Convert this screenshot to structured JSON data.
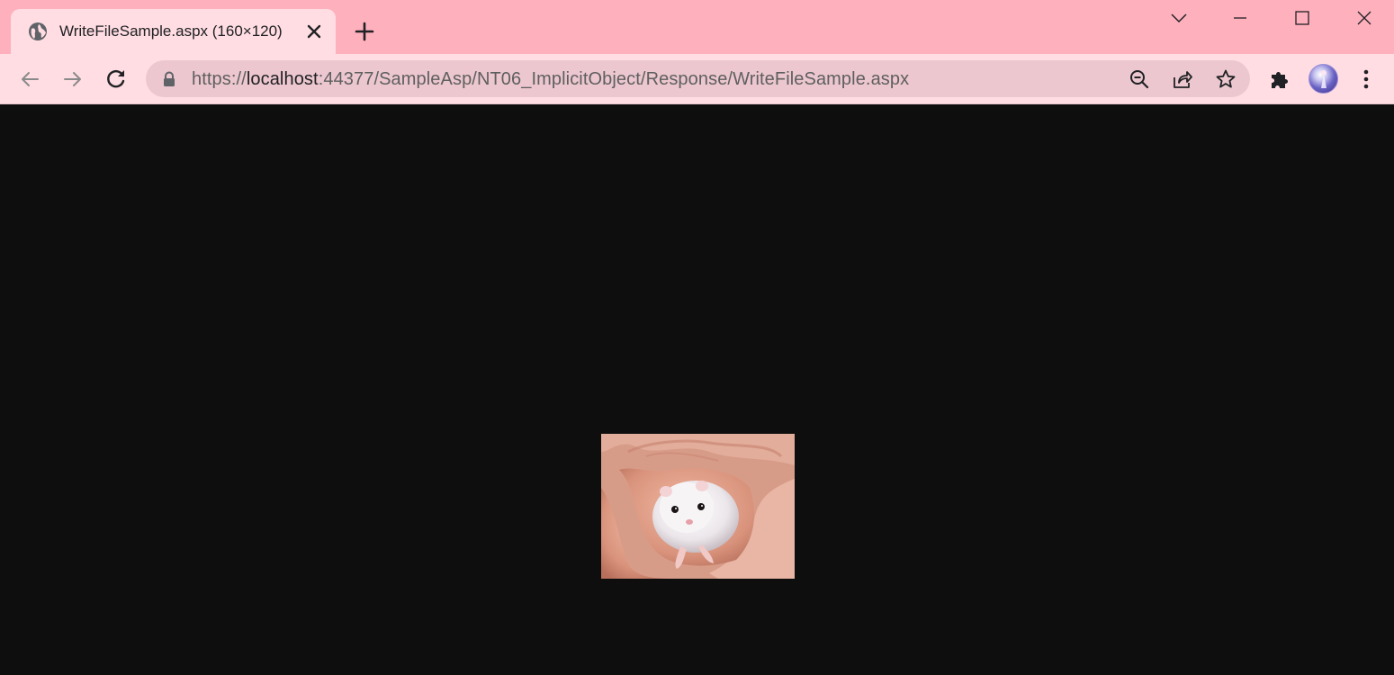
{
  "tab": {
    "title": "WriteFileSample.aspx (160×120)",
    "favicon": "globe-icon"
  },
  "toolbar": {
    "url_scheme": "https://",
    "url_host": "localhost",
    "url_rest": ":44377/SampleAsp/NT06_ImplicitObject/Response/WriteFileSample.aspx"
  },
  "icons": {
    "back": "arrow-left-icon",
    "forward": "arrow-right-icon",
    "reload": "reload-icon",
    "lock": "lock-icon",
    "zoom": "zoom-out-icon",
    "share": "share-icon",
    "bookmark": "star-icon",
    "extensions": "puzzle-icon",
    "menu": "kebab-menu-icon"
  },
  "colors": {
    "tab_strip": "#ffb0bd",
    "toolbar": "#ffdde3",
    "omnibox": "#ecc7cf",
    "page_background": "#0e0e0e"
  },
  "image": {
    "description_alt": "hamster-in-hands"
  }
}
